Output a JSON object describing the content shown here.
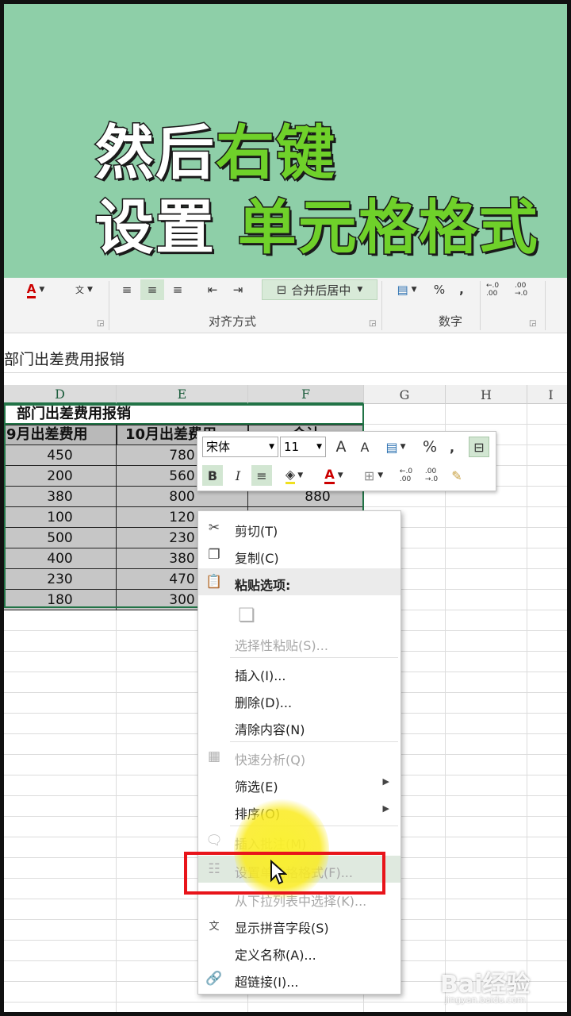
{
  "banner": {
    "line1_a": "然后",
    "line1_b": "右键",
    "line2_a": "设置",
    "line2_b": "单元格格式"
  },
  "ribbon": {
    "merge_label": "合并后居中",
    "percent": "%",
    "comma": ",",
    "group_align": "对齐方式",
    "group_number": "数字",
    "inc_decimal": "←.0 .00",
    "dec_decimal": ".00 →.0"
  },
  "formula_bar": {
    "content": "部门出差费用报销"
  },
  "columns": [
    "D",
    "E",
    "F",
    "G",
    "H",
    "I"
  ],
  "table": {
    "title": "部门出差费用报销",
    "headers": [
      "9月出差费用",
      "10月出差费用",
      "合计"
    ],
    "col_d": [
      "450",
      "200",
      "380",
      "100",
      "500",
      "400",
      "230",
      "180"
    ],
    "col_e": [
      "780",
      "560",
      "800",
      "120",
      "230",
      "380",
      "470",
      "300"
    ],
    "col_f_visible": "880"
  },
  "mini_toolbar": {
    "font_name": "宋体",
    "font_size": "11",
    "grow_font": "A",
    "shrink_font": "A",
    "percent": "%",
    "comma": ",",
    "bold": "B",
    "italic": "I",
    "font_color": "A"
  },
  "menu": {
    "cut": "剪切(T)",
    "copy": "复制(C)",
    "paste_options": "粘贴选项:",
    "paste_special": "选择性粘贴(S)...",
    "insert": "插入(I)...",
    "delete": "删除(D)...",
    "clear": "清除内容(N)",
    "quick_analysis": "快速分析(Q)",
    "filter": "筛选(E)",
    "sort": "排序(O)",
    "insert_comment": "插入批注(M)",
    "format_cells": "设置单元格格式(F)...",
    "pick_from_list": "从下拉列表中选择(K)...",
    "phonetic": "显示拼音字段(S)",
    "define_name": "定义名称(A)...",
    "hyperlink": "超链接(I)..."
  },
  "watermark": {
    "brand": "Bai经验",
    "url": "jingyan.baidu.com"
  }
}
